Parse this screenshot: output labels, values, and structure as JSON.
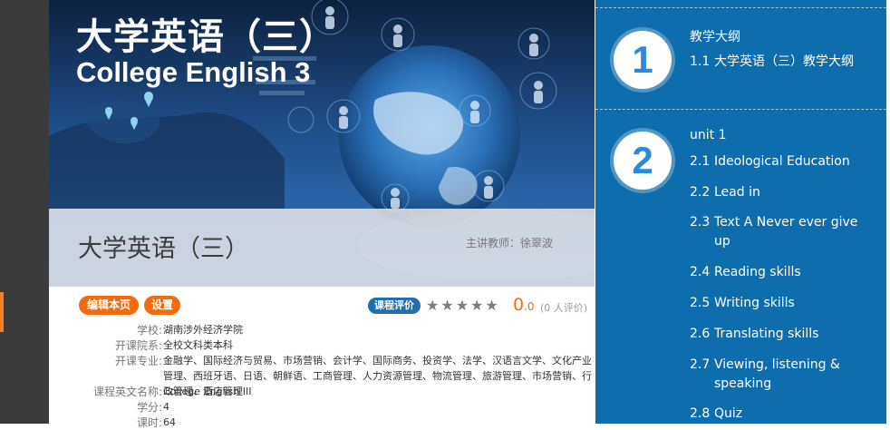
{
  "banner": {
    "title_zh": "大学英语（三）",
    "title_en": "College English 3"
  },
  "overlay": {
    "title": "大学英语（三）",
    "teacher": "主讲教师：徐翠波"
  },
  "actions": {
    "edit_label": "编辑本页",
    "settings_label": "设置",
    "rate_label": "课程评价"
  },
  "rating": {
    "stars_filled": 0,
    "stars_total": 5,
    "score_main": "0",
    "score_decimal": ".0",
    "count_text": "(0 人评价)"
  },
  "course_info": [
    {
      "label": "学校:",
      "value": "湖南涉外经济学院"
    },
    {
      "label": "开课院系:",
      "value": "全校文科类本科"
    },
    {
      "label": "开课专业:",
      "value": "金融学、国际经济与贸易、市场营销、会计学、国际商务、投资学、法学、汉语言文学、文化产业管理、西班牙语、日语、朝鲜语、工商管理、人力资源管理、物流管理、旅游管理、市场营销、行政管理、酒店管理"
    },
    {
      "label": "课程英文名称:",
      "value": "College English III"
    },
    {
      "label": "学分:",
      "value": "4"
    },
    {
      "label": "课时:",
      "value": "64"
    }
  ],
  "sidebar": {
    "sections": [
      {
        "number": "1",
        "heading": "教学大纲",
        "items": [
          {
            "num": "1.1",
            "label": "大学英语（三）教学大纲"
          }
        ]
      },
      {
        "number": "2",
        "heading": "unit 1",
        "items": [
          {
            "num": "2.1",
            "label": "Ideological Education"
          },
          {
            "num": "2.2",
            "label": "Lead in"
          },
          {
            "num": "2.3",
            "label": "Text A Never ever give up"
          },
          {
            "num": "2.4",
            "label": "Reading skills"
          },
          {
            "num": "2.5",
            "label": "Writing skills"
          },
          {
            "num": "2.6",
            "label": "Translating skills"
          },
          {
            "num": "2.7",
            "label": "Viewing, listening & speaking"
          },
          {
            "num": "2.8",
            "label": "Quiz"
          }
        ]
      }
    ]
  },
  "colors": {
    "accent_orange": "#f26b0f",
    "sidebar_blue": "#0e6dad",
    "rate_badge_blue": "#1f6fb2"
  }
}
